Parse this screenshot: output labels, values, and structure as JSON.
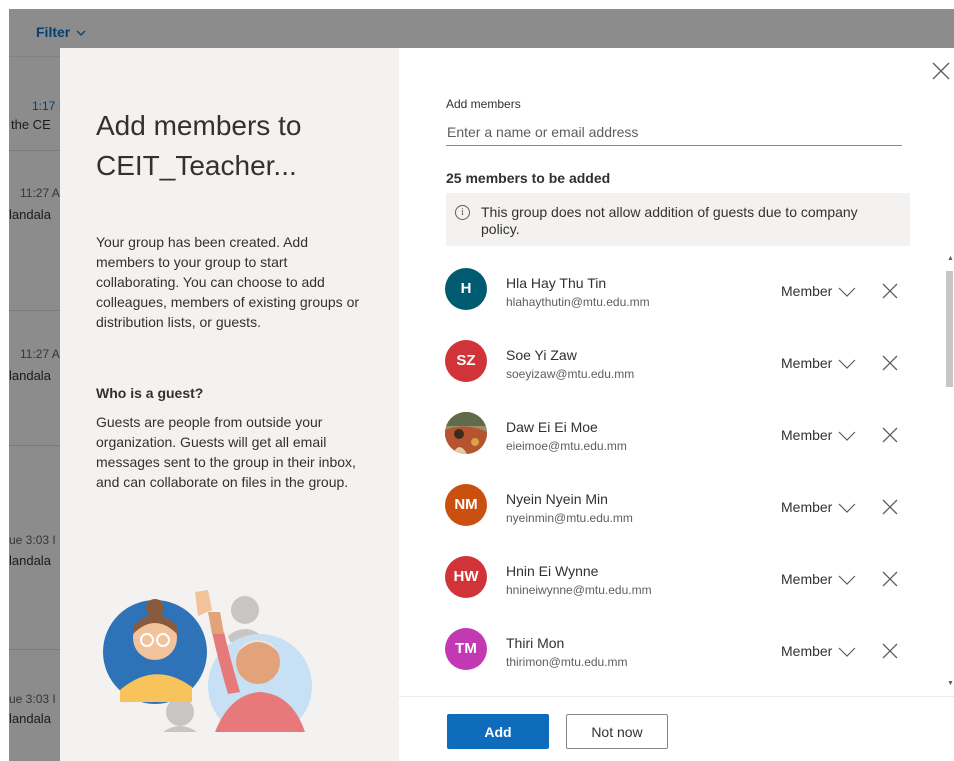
{
  "background": {
    "filter_label": "Filter",
    "rows": [
      {
        "time": "1:17 I",
        "subject": "the CE"
      },
      {
        "time": "11:27 A",
        "subject": "landala"
      },
      {
        "time": "11:27 A",
        "subject": "landala"
      },
      {
        "time": "ue 3:03 I",
        "subject": "landala"
      },
      {
        "time": "ue 3:03 I",
        "subject": "landala"
      }
    ]
  },
  "dialog": {
    "title": "Add members to CEIT_Teacher...",
    "description": "Your group has been created. Add members to your group to start collaborating. You can choose to add colleagues, members of existing groups or distribution lists, or guests.",
    "guest_heading": "Who is a guest?",
    "guest_text": "Guests are people from outside your organization. Guests will get all email messages sent to the group in their inbox, and can collaborate on files in the group.",
    "add_members_label": "Add members",
    "add_members_placeholder": "Enter a name or email address",
    "members_count_label": "25 members to be added",
    "guest_policy_note": "This group does not allow addition of guests due to company policy.",
    "add_button": "Add",
    "not_now_button": "Not now"
  },
  "members": [
    {
      "initials": "H",
      "name": "Hla Hay Thu Tin",
      "email": "hlahaythutin@mtu.edu.mm",
      "role": "Member",
      "color": "#005b70"
    },
    {
      "initials": "SZ",
      "name": "Soe Yi Zaw",
      "email": "soeyizaw@mtu.edu.mm",
      "role": "Member",
      "color": "#d13438"
    },
    {
      "initials": "",
      "name": "Daw Ei Ei Moe",
      "email": "eieimoe@mtu.edu.mm",
      "role": "Member",
      "color": "#8a6a3a",
      "photo": true
    },
    {
      "initials": "NM",
      "name": "Nyein Nyein Min",
      "email": "nyeinmin@mtu.edu.mm",
      "role": "Member",
      "color": "#ca5010"
    },
    {
      "initials": "HW",
      "name": "Hnin Ei Wynne",
      "email": "hnineiwynne@mtu.edu.mm",
      "role": "Member",
      "color": "#d13438"
    },
    {
      "initials": "TM",
      "name": "Thiri Mon",
      "email": "thirimon@mtu.edu.mm",
      "role": "Member",
      "color": "#c239b3"
    }
  ],
  "colors": {
    "primary": "#0f6cbd",
    "panel": "#f3f2f1"
  }
}
